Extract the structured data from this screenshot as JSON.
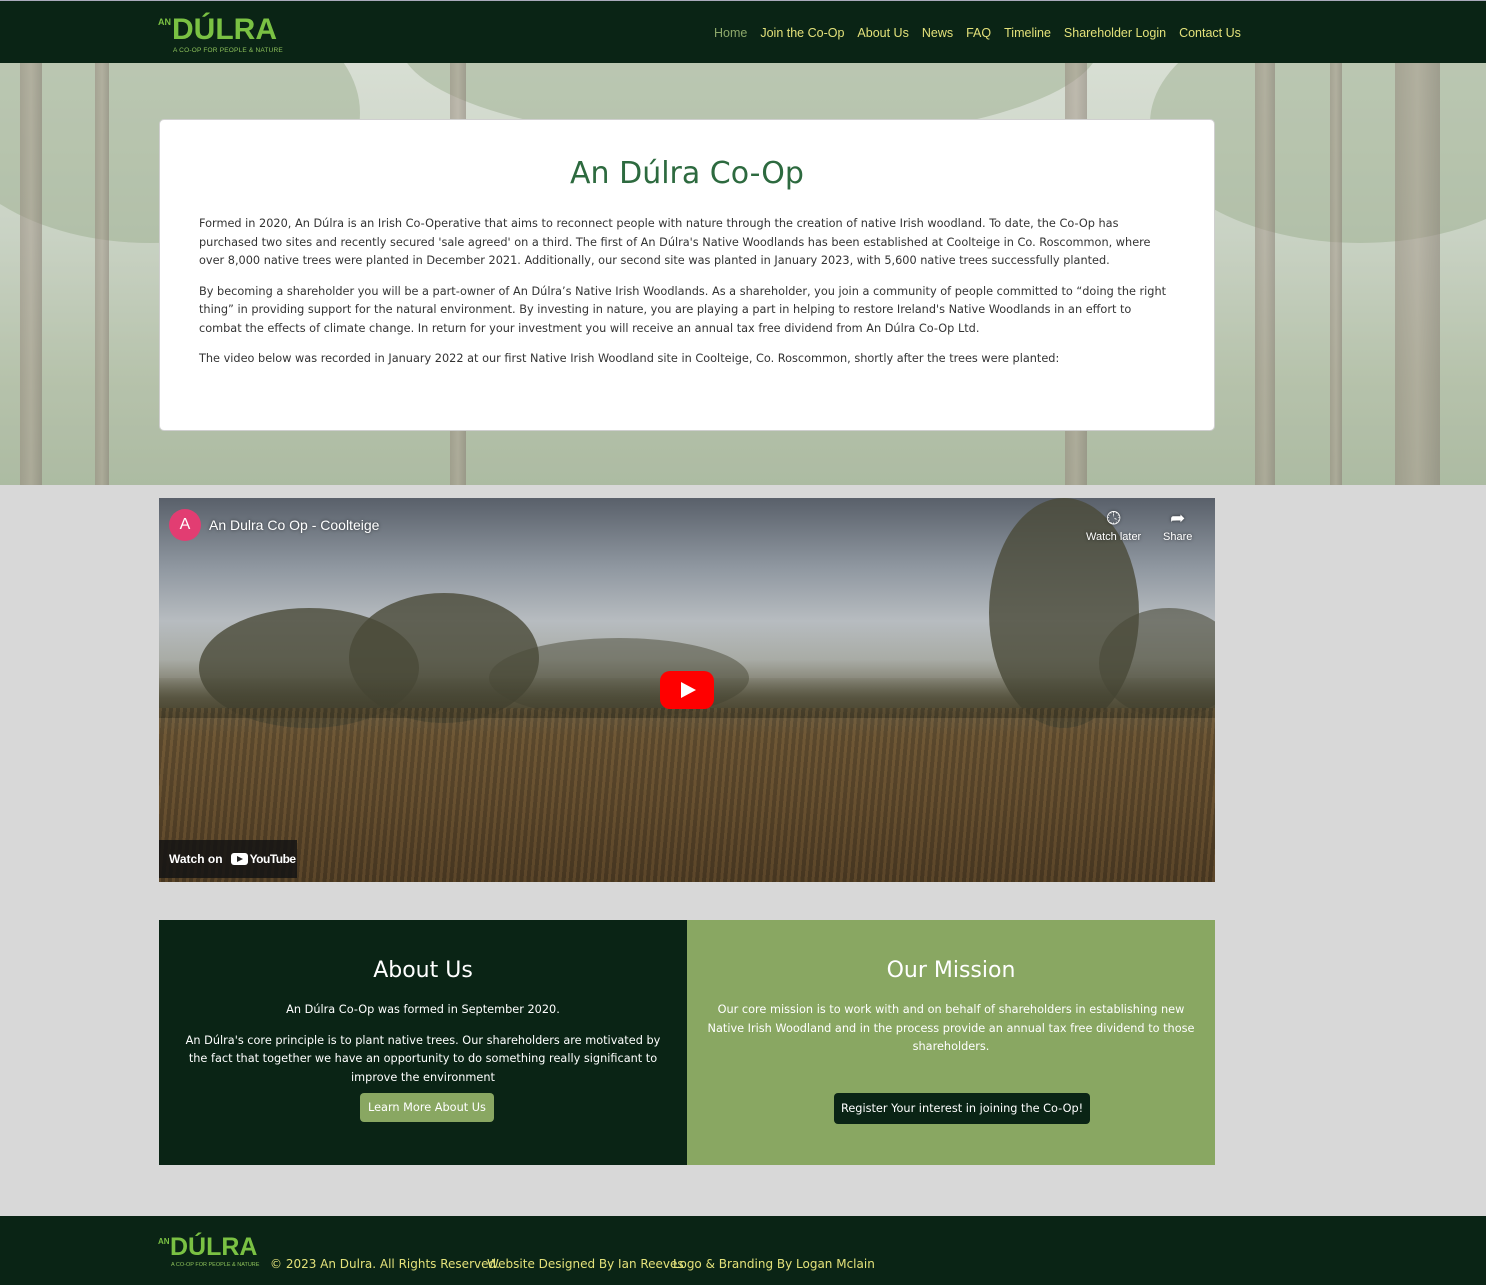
{
  "brand": {
    "prefix": "AN",
    "name": "DÚLRA",
    "tagline": "A CO-OP FOR PEOPLE & NATURE"
  },
  "nav": [
    {
      "label": "Home",
      "active": true
    },
    {
      "label": "Join the Co-Op",
      "active": false
    },
    {
      "label": "About Us",
      "active": false
    },
    {
      "label": "News",
      "active": false
    },
    {
      "label": "FAQ",
      "active": false
    },
    {
      "label": "Timeline",
      "active": false
    },
    {
      "label": "Shareholder Login",
      "active": false
    },
    {
      "label": "Contact Us",
      "active": false
    }
  ],
  "intro": {
    "title": "An Dúlra Co-Op",
    "paragraphs": [
      "Formed in 2020, An Dúlra is an Irish Co-Operative that aims to reconnect people with nature through the creation of native Irish woodland. To date, the Co-Op has purchased two sites and recently secured 'sale agreed' on a third. The first of An Dúlra's Native Woodlands has been established at Coolteige in Co. Roscommon, where over 8,000 native trees were planted in December 2021. Additionally, our second site was planted in January 2023, with 5,600 native trees successfully planted.",
      "By becoming a shareholder you will be a part-owner of An Dúlra’s Native Irish Woodlands. As a shareholder, you join a community of people committed to “doing the right thing” in providing support for the natural environment. By investing in nature, you are playing a part in helping to restore Ireland's Native Woodlands in an effort to combat the effects of climate change. In return for your investment you will receive an annual tax free dividend from An Dúlra Co-Op Ltd.",
      "The video below was recorded in January 2022 at our first Native Irish Woodland site in Coolteige, Co. Roscommon, shortly after the trees were planted:"
    ]
  },
  "video": {
    "channel_initial": "A",
    "title": "An Dulra Co Op - Coolteige",
    "watch_later": "Watch later",
    "share": "Share",
    "watch_on": "Watch on",
    "youtube": "YouTube"
  },
  "about": {
    "heading": "About Us",
    "paragraphs": [
      "An Dúlra Co-Op was formed in September 2020.",
      "An Dúlra's core principle is to plant native trees. Our shareholders are motivated by the fact that together we have an opportunity to do something really significant to improve the environment"
    ],
    "button": "Learn More About Us"
  },
  "mission": {
    "heading": "Our Mission",
    "paragraphs": [
      "Our core mission is to work with and on behalf of shareholders in establishing new Native Irish Woodland and in the process provide an annual tax free dividend to those shareholders."
    ],
    "button": "Register Your interest in joining the Co-Op!"
  },
  "footer": {
    "copyright": "© 2023 An Dulra. All Rights Reserved.",
    "designer": "Website Designed By Ian Reeves",
    "branding": "Logo & Branding By Logan Mclain"
  },
  "colors": {
    "dark_green": "#0a2415",
    "light_green": "#89a762",
    "nav_text": "#e3e17a",
    "heading_green": "#2d6a3f",
    "play_red": "#ff0000"
  }
}
